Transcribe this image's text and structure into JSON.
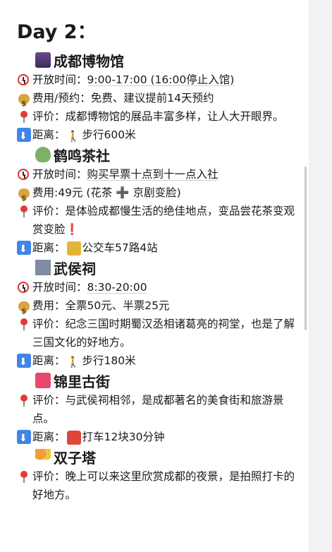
{
  "day_title": "Day 2：",
  "places": [
    {
      "name": "成都博物馆",
      "lines": [
        {
          "icon": "alarm-clock-icon",
          "label": "开放时间：",
          "value": "9:00-17:00 (16:00停止入馆)"
        },
        {
          "icon": "money-bag-icon",
          "label": "费用/预约：",
          "value": "免费、建议提前14天预约"
        },
        {
          "icon": "pin-icon",
          "label": "评价：",
          "value": "成都博物馆的展品丰富多样，让人大开眼界。"
        },
        {
          "icon": "down-arrow-icon",
          "label": "距离：",
          "value": "步行600米",
          "transport_icon": "walking-person-icon"
        }
      ]
    },
    {
      "name": "鹤鸣茶社",
      "lines": [
        {
          "icon": "alarm-clock-icon",
          "label": "开放时间：",
          "value": "购买早票十点到十一点入社"
        },
        {
          "icon": "money-bag-icon",
          "label": "费用:",
          "value": "49元 (花茶 ➕ 京剧变脸)"
        },
        {
          "icon": "pin-icon",
          "label": "评价：",
          "value": "是体验成都慢生活的绝佳地点，变品尝花茶变观赏变脸❗"
        },
        {
          "icon": "down-arrow-icon",
          "label": "距离：",
          "value": "公交车57路4站",
          "transport_icon": "bus-icon"
        }
      ]
    },
    {
      "name": "武侯祠",
      "lines": [
        {
          "icon": "alarm-clock-icon",
          "label": "开放时间：",
          "value": "8:30-20:00"
        },
        {
          "icon": "money-bag-icon",
          "label": "费用：",
          "value": "全票50元、半票25元"
        },
        {
          "icon": "pin-icon",
          "label": "评价：",
          "value": "纪念三国时期蜀汉丞相诸葛亮的祠堂，也是了解三国文化的好地方。"
        },
        {
          "icon": "down-arrow-icon",
          "label": "距离：",
          "value": "步行180米",
          "transport_icon": "walking-person-icon"
        }
      ]
    },
    {
      "name": "锦里古街",
      "lines": [
        {
          "icon": "pin-icon",
          "label": "评价：",
          "value": "与武侯祠相邻，是成都著名的美食街和旅游景点。"
        },
        {
          "icon": "down-arrow-icon",
          "label": "距离：",
          "value": "打车12块30分钟",
          "transport_icon": "car-icon"
        }
      ]
    },
    {
      "name": "双子塔",
      "lines": [
        {
          "icon": "pin-icon",
          "label": "评价：",
          "value": "晚上可以来这里欣赏成都的夜景，是拍照打卡的好地方。"
        }
      ]
    }
  ]
}
